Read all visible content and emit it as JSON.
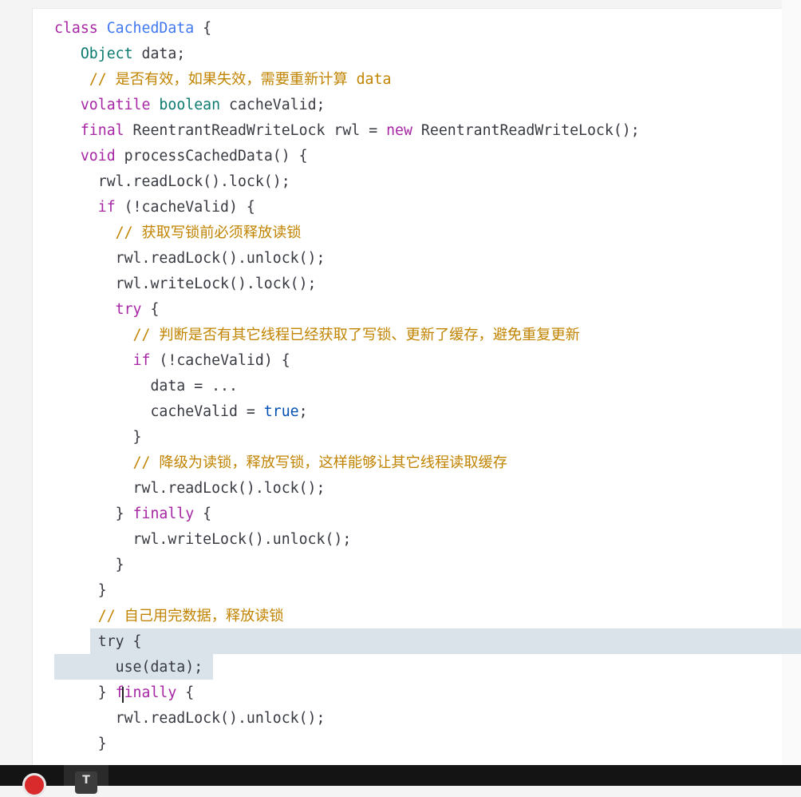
{
  "code": {
    "lines": [
      [
        {
          "t": "class ",
          "c": "kw"
        },
        {
          "t": "CachedData",
          "c": "ty"
        },
        {
          "t": " {",
          "c": ""
        }
      ],
      [
        {
          "t": "   ",
          "c": ""
        },
        {
          "t": "Object",
          "c": "tp"
        },
        {
          "t": " data;",
          "c": ""
        }
      ],
      [
        {
          "t": "    ",
          "c": ""
        },
        {
          "t": "// 是否有效，如果失效，需要重新计算 data",
          "c": "cm"
        }
      ],
      [
        {
          "t": "   ",
          "c": ""
        },
        {
          "t": "volatile",
          "c": "kw"
        },
        {
          "t": " ",
          "c": ""
        },
        {
          "t": "boolean",
          "c": "tp"
        },
        {
          "t": " cacheValid;",
          "c": ""
        }
      ],
      [
        {
          "t": "   ",
          "c": ""
        },
        {
          "t": "final",
          "c": "kw"
        },
        {
          "t": " ReentrantReadWriteLock rwl = ",
          "c": ""
        },
        {
          "t": "new",
          "c": "kw"
        },
        {
          "t": " ReentrantReadWriteLock();",
          "c": ""
        }
      ],
      [
        {
          "t": "   ",
          "c": ""
        },
        {
          "t": "void",
          "c": "kw"
        },
        {
          "t": " processCachedData() {",
          "c": ""
        }
      ],
      [
        {
          "t": "     rwl.readLock().lock();",
          "c": ""
        }
      ],
      [
        {
          "t": "     ",
          "c": ""
        },
        {
          "t": "if",
          "c": "kw"
        },
        {
          "t": " (!cacheValid) {",
          "c": ""
        }
      ],
      [
        {
          "t": "       ",
          "c": ""
        },
        {
          "t": "// 获取写锁前必须释放读锁",
          "c": "cm"
        }
      ],
      [
        {
          "t": "       rwl.readLock().unlock();",
          "c": ""
        }
      ],
      [
        {
          "t": "       rwl.writeLock().lock();",
          "c": ""
        }
      ],
      [
        {
          "t": "       ",
          "c": ""
        },
        {
          "t": "try",
          "c": "kw"
        },
        {
          "t": " {",
          "c": ""
        }
      ],
      [
        {
          "t": "         ",
          "c": ""
        },
        {
          "t": "// 判断是否有其它线程已经获取了写锁、更新了缓存，避免重复更新",
          "c": "cm"
        }
      ],
      [
        {
          "t": "         ",
          "c": ""
        },
        {
          "t": "if",
          "c": "kw"
        },
        {
          "t": " (!cacheValid) {",
          "c": ""
        }
      ],
      [
        {
          "t": "           data = ...",
          "c": ""
        }
      ],
      [
        {
          "t": "           cacheValid = ",
          "c": ""
        },
        {
          "t": "true",
          "c": "lit"
        },
        {
          "t": ";",
          "c": ""
        }
      ],
      [
        {
          "t": "         }",
          "c": ""
        }
      ],
      [
        {
          "t": "         ",
          "c": ""
        },
        {
          "t": "// 降级为读锁，释放写锁，这样能够让其它线程读取缓存",
          "c": "cm"
        }
      ],
      [
        {
          "t": "         rwl.readLock().lock();",
          "c": ""
        }
      ],
      [
        {
          "t": "       } ",
          "c": ""
        },
        {
          "t": "finally",
          "c": "kw"
        },
        {
          "t": " {",
          "c": ""
        }
      ],
      [
        {
          "t": "         rwl.writeLock().unlock();",
          "c": ""
        }
      ],
      [
        {
          "t": "       }",
          "c": ""
        }
      ],
      [
        {
          "t": "     }",
          "c": ""
        }
      ],
      [
        {
          "t": "     ",
          "c": ""
        },
        {
          "t": "// 自己用完数据，释放读锁",
          "c": "cm"
        }
      ],
      [
        {
          "t": "     try {",
          "c": ""
        }
      ],
      [
        {
          "t": "       use(data);",
          "c": ""
        }
      ],
      [
        {
          "t": "     } ",
          "c": ""
        },
        {
          "t": "finally",
          "c": "kw"
        },
        {
          "t": " {",
          "c": ""
        }
      ],
      [
        {
          "t": "       rwl.readLock().unlock();",
          "c": ""
        }
      ],
      [
        {
          "t": "     }",
          "c": ""
        }
      ]
    ]
  },
  "colors": {
    "keyword": "#a626a4",
    "type": "#4078f2",
    "primitive": "#0c7a6e",
    "comment": "#c18401",
    "literal": "#0050b3",
    "selection": "#dbe3ea"
  },
  "taskbar": {
    "icons": [
      "record-icon",
      "typora-app-icon"
    ],
    "app_icon_letter": "T"
  }
}
